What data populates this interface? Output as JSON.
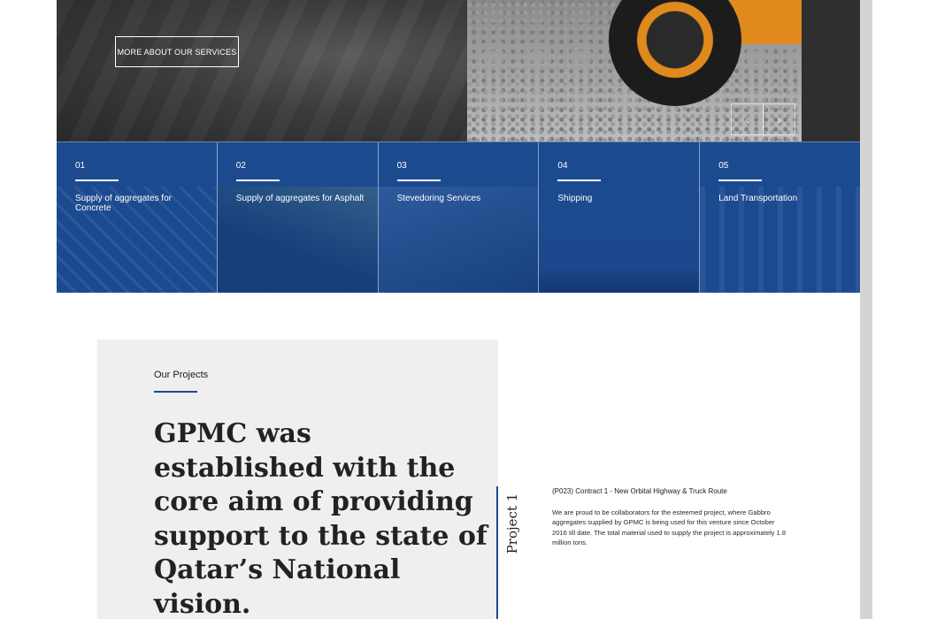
{
  "hero": {
    "cta_label": "MORE ABOUT OUR SERVICES",
    "prev_icon": "chevron-left",
    "next_icon": "chevron-right"
  },
  "services": [
    {
      "number": "01",
      "title": "Supply of aggregates for Concrete"
    },
    {
      "number": "02",
      "title": "Supply of aggregates for Asphalt"
    },
    {
      "number": "03",
      "title": "Stevedoring Services"
    },
    {
      "number": "04",
      "title": "Shipping"
    },
    {
      "number": "05",
      "title": "Land Transportation"
    }
  ],
  "projects": {
    "label": "Our Projects",
    "heading": "GPMC was established with the core aim of providing support to the state of Qatar’s National vision.",
    "slide_label": "Project 1",
    "item": {
      "title": "(P023) Contract 1 - New Orbital Highway & Truck Route",
      "description": "We are proud to be collaborators for the esteemed project, where Gabbro aggregates supplied by GPMC is being used for this venture since October 2016 till date. The total material used to supply the project is approximately 1.8 million tons."
    }
  },
  "colors": {
    "brand_blue": "#1c4a8f",
    "panel_gray": "#efefef"
  }
}
